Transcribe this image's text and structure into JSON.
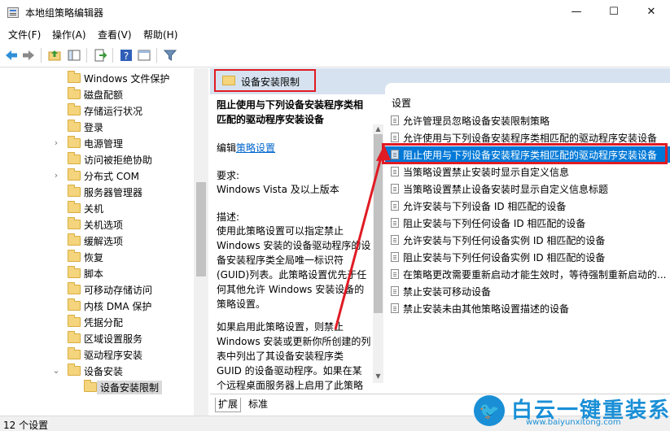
{
  "window": {
    "title": "本地组策略编辑器",
    "minimize": "—",
    "maximize": "☐",
    "close": "✕"
  },
  "menu": [
    "文件(F)",
    "操作(A)",
    "查看(V)",
    "帮助(H)"
  ],
  "tree": {
    "items": [
      {
        "label": "Windows 文件保护",
        "expandable": false
      },
      {
        "label": "磁盘配额",
        "expandable": false
      },
      {
        "label": "存储运行状况",
        "expandable": false
      },
      {
        "label": "登录",
        "expandable": false
      },
      {
        "label": "电源管理",
        "expandable": true
      },
      {
        "label": "访问被拒绝协助",
        "expandable": false
      },
      {
        "label": "分布式 COM",
        "expandable": true
      },
      {
        "label": "服务器管理器",
        "expandable": false
      },
      {
        "label": "关机",
        "expandable": false
      },
      {
        "label": "关机选项",
        "expandable": false
      },
      {
        "label": "缓解选项",
        "expandable": false
      },
      {
        "label": "恢复",
        "expandable": false
      },
      {
        "label": "脚本",
        "expandable": false
      },
      {
        "label": "可移动存储访问",
        "expandable": false
      },
      {
        "label": "内核 DMA 保护",
        "expandable": false
      },
      {
        "label": "凭据分配",
        "expandable": false
      },
      {
        "label": "区域设置服务",
        "expandable": false
      },
      {
        "label": "驱动程序安装",
        "expandable": false
      },
      {
        "label": "设备安装",
        "expandable": true,
        "expanded": true
      },
      {
        "label": "设备安装限制",
        "expandable": false,
        "selected": true,
        "child": true
      }
    ]
  },
  "header": {
    "title": "设备安装限制"
  },
  "description": {
    "title": "阻止使用与下列设备安装程序类相匹配的驱动程序安装设备",
    "edit_prefix": "编辑",
    "edit_link": "策略设置",
    "requirements_label": "要求:",
    "requirements": "Windows Vista 及以上版本",
    "desc_label": "描述:",
    "desc_body": "使用此策略设置可以指定禁止 Windows 安装的设备驱动程序的设备安装程序类全局唯一标识符(GUID)列表。此策略设置优先于任何其他允许 Windows 安装设备的策略设置。",
    "desc_body2": "如果启用此策略设置，则禁止 Windows 安装或更新你所创建的列表中列出了其设备安装程序类 GUID 的设备驱动程序。如果在某个远程桌面服务器上启用了此策略设置，则此策略设置会影响指定设"
  },
  "list": {
    "column_header": "设置",
    "items": [
      {
        "label": "允许管理员忽略设备安装限制策略"
      },
      {
        "label": "允许使用与下列设备安装程序类相匹配的驱动程序安装设备"
      },
      {
        "label": "阻止使用与下列设备安装程序类相匹配的驱动程序安装设备",
        "selected": true
      },
      {
        "label": "当策略设置禁止安装时显示自定义信息"
      },
      {
        "label": "当策略设置禁止设备安装时显示自定义信息标题"
      },
      {
        "label": "允许安装与下列设备 ID 相匹配的设备"
      },
      {
        "label": "阻止安装与下列任何设备 ID 相匹配的设备"
      },
      {
        "label": "允许安装与下列任何设备实例 ID 相匹配的设备"
      },
      {
        "label": "阻止安装与下列任何设备实例 ID 相匹配的设备"
      },
      {
        "label": "在策略更改需要重新启动才能生效时，等待强制重新启动的..."
      },
      {
        "label": "禁止安装可移动设备"
      },
      {
        "label": "禁止安装未由其他策略设置描述的设备"
      }
    ]
  },
  "tabs": [
    "扩展",
    "标准"
  ],
  "status": {
    "text": "12 个设置"
  },
  "watermark": {
    "name": "白云一键重装系统",
    "url": "www.baiyunxitong.com",
    "icon": "twitter-bird-icon"
  },
  "colors": {
    "selection": "#0078d7",
    "highlight_box": "#e01b24",
    "header_strip": "#d6e2ef",
    "link": "#0066cc",
    "brand": "#1a8fd6"
  }
}
